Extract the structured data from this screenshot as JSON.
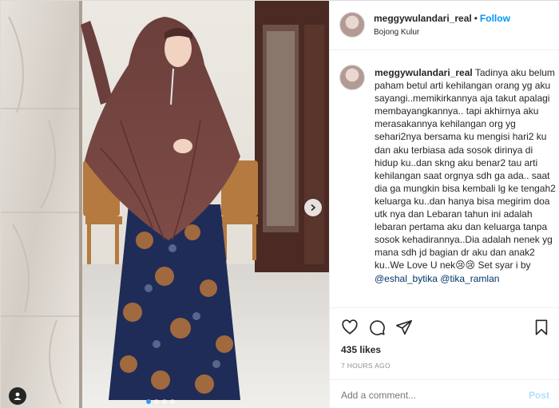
{
  "post": {
    "username": "meggywulandari_real",
    "separator": "•",
    "follow_label": "Follow",
    "location": "Bojong Kulur",
    "caption_username": "meggywulandari_real",
    "caption_text": "Tadinya aku belum paham betul arti kehilangan orang yg aku sayangi..memikirkannya aja takut apalagi membayangkannya.. tapi akhirnya aku merasakannya kehilangan org yg sehari2nya bersama ku mengisi hari2 ku dan aku terbiasa ada sosok dirinya di hidup ku..dan skng aku benar2 tau arti kehilangan saat orgnya sdh ga ada.. saat dia ga mungkin bisa kembali lg ke tengah2 keluarga ku..dan hanya bisa megirim doa utk nya dan Lebaran tahun ini adalah lebaran pertama aku dan keluarga tanpa sosok kehadirannya..Dia adalah nenek yg mana sdh jd bagian dr aku dan anak2 ku..We Love U nek😢😢 Set syar i by",
    "mention_1": "@eshal_bytika",
    "mention_2": "@tika_ramlan",
    "likes": "435 likes",
    "time_ago": "7 HOURS AGO",
    "comment_placeholder": "Add a comment...",
    "post_button": "Post"
  },
  "carousel": {
    "total": 4,
    "active_index": 0
  },
  "icons": {
    "like": "heart-icon",
    "comment": "comment-icon",
    "share": "paper-plane-icon",
    "save": "bookmark-icon",
    "next": "chevron-right-icon",
    "tags": "user-tag-icon"
  },
  "colors": {
    "accent": "#0095f6",
    "text": "#262626",
    "muted": "#8e8e8e",
    "link": "#00376b"
  }
}
